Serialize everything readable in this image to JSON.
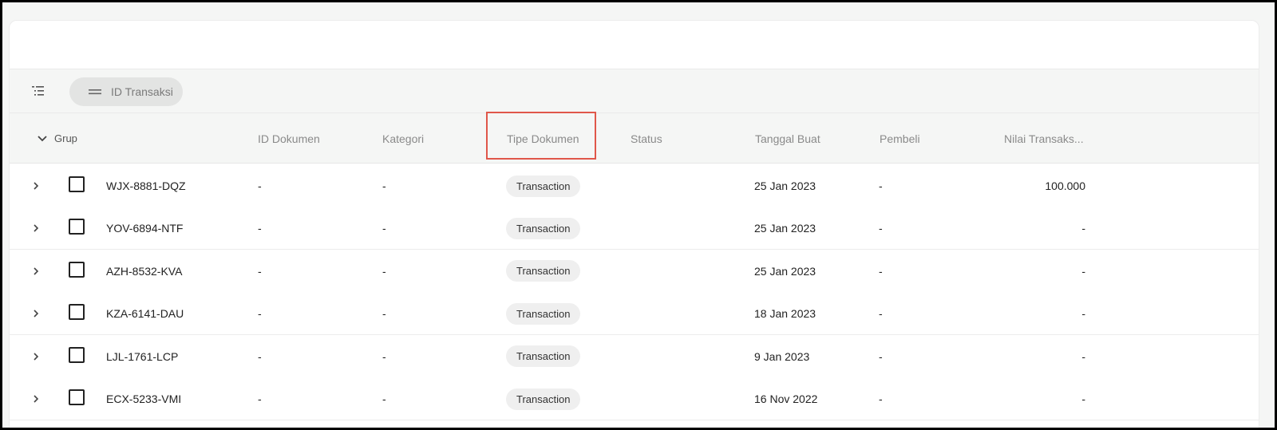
{
  "toolbar": {
    "group_icon": "list-tree-icon",
    "chip_icon": "drag-handle-icon",
    "chip_label": "ID Transaksi"
  },
  "columns": {
    "grup": "Grup",
    "id_dokumen": "ID Dokumen",
    "kategori": "Kategori",
    "tipe_dokumen": "Tipe Dokumen",
    "status": "Status",
    "tanggal_buat": "Tanggal Buat",
    "pembeli": "Pembeli",
    "nilai_transaksi": "Nilai Transaks..."
  },
  "highlight_color": "#e0574a",
  "rows": [
    {
      "id": "WJX-8881-DQZ",
      "id_dokumen": "-",
      "kategori": "-",
      "tipe": "Transaction",
      "status": "",
      "tanggal": "25 Jan 2023",
      "pembeli": "-",
      "nilai": "100.000"
    },
    {
      "id": "YOV-6894-NTF",
      "id_dokumen": "-",
      "kategori": "-",
      "tipe": "Transaction",
      "status": "",
      "tanggal": "25 Jan 2023",
      "pembeli": "-",
      "nilai": "-"
    },
    {
      "id": "AZH-8532-KVA",
      "id_dokumen": "-",
      "kategori": "-",
      "tipe": "Transaction",
      "status": "",
      "tanggal": "25 Jan 2023",
      "pembeli": "-",
      "nilai": "-"
    },
    {
      "id": "KZA-6141-DAU",
      "id_dokumen": "-",
      "kategori": "-",
      "tipe": "Transaction",
      "status": "",
      "tanggal": "18 Jan 2023",
      "pembeli": "-",
      "nilai": "-"
    },
    {
      "id": "LJL-1761-LCP",
      "id_dokumen": "-",
      "kategori": "-",
      "tipe": "Transaction",
      "status": "",
      "tanggal": "9 Jan 2023",
      "pembeli": "-",
      "nilai": "-"
    },
    {
      "id": "ECX-5233-VMI",
      "id_dokumen": "-",
      "kategori": "-",
      "tipe": "Transaction",
      "status": "",
      "tanggal": "16 Nov 2022",
      "pembeli": "-",
      "nilai": "-"
    }
  ]
}
